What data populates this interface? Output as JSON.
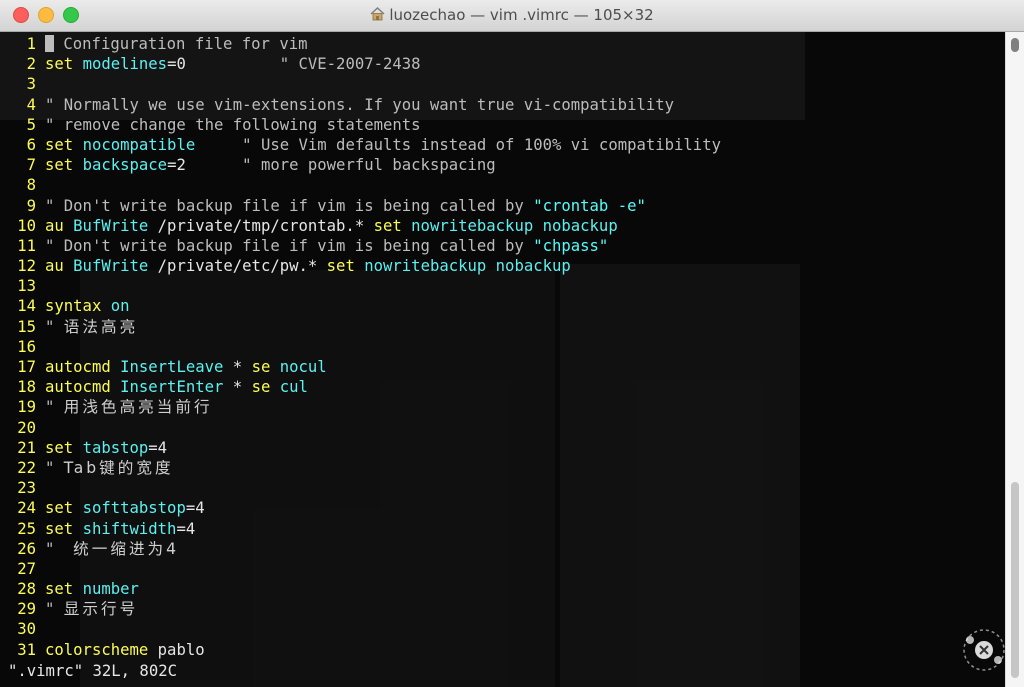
{
  "window": {
    "title": "luozechao — vim .vimrc — 105×32"
  },
  "editor": {
    "lines": [
      {
        "n": "1",
        "parts": [
          {
            "t": "cursor",
            "v": ""
          },
          {
            "t": "cmt",
            "v": " Configuration file for vim"
          }
        ]
      },
      {
        "n": "2",
        "parts": [
          {
            "t": "kw",
            "v": "set"
          },
          {
            "t": "txt",
            "v": " "
          },
          {
            "t": "opt",
            "v": "modelines"
          },
          {
            "t": "txt",
            "v": "=0"
          },
          {
            "t": "cmt",
            "v": "          \" CVE-2007-2438"
          }
        ]
      },
      {
        "n": "3",
        "parts": []
      },
      {
        "n": "4",
        "parts": [
          {
            "t": "cmt",
            "v": "\" Normally we use vim-extensions. If you want true vi-compatibility"
          }
        ]
      },
      {
        "n": "5",
        "parts": [
          {
            "t": "cmt",
            "v": "\" remove change the following statements"
          }
        ]
      },
      {
        "n": "6",
        "parts": [
          {
            "t": "kw",
            "v": "set"
          },
          {
            "t": "txt",
            "v": " "
          },
          {
            "t": "opt",
            "v": "nocompatible"
          },
          {
            "t": "cmt",
            "v": "     \" Use Vim defaults instead of 100% vi compatibility"
          }
        ]
      },
      {
        "n": "7",
        "parts": [
          {
            "t": "kw",
            "v": "set"
          },
          {
            "t": "txt",
            "v": " "
          },
          {
            "t": "opt",
            "v": "backspace"
          },
          {
            "t": "txt",
            "v": "=2"
          },
          {
            "t": "cmt",
            "v": "      \" more powerful backspacing"
          }
        ]
      },
      {
        "n": "8",
        "parts": []
      },
      {
        "n": "9",
        "parts": [
          {
            "t": "cmt",
            "v": "\" Don't write backup file if vim is being called by "
          },
          {
            "t": "str",
            "v": "\"crontab -e\""
          }
        ]
      },
      {
        "n": "10",
        "parts": [
          {
            "t": "kw",
            "v": "au"
          },
          {
            "t": "txt",
            "v": " "
          },
          {
            "t": "opt",
            "v": "BufWrite"
          },
          {
            "t": "txt",
            "v": " /private/tmp/crontab.* "
          },
          {
            "t": "kw",
            "v": "set"
          },
          {
            "t": "txt",
            "v": " "
          },
          {
            "t": "opt",
            "v": "nowritebackup nobackup"
          }
        ]
      },
      {
        "n": "11",
        "parts": [
          {
            "t": "cmt",
            "v": "\" Don't write backup file if vim is being called by "
          },
          {
            "t": "str",
            "v": "\"chpass\""
          }
        ]
      },
      {
        "n": "12",
        "parts": [
          {
            "t": "kw",
            "v": "au"
          },
          {
            "t": "txt",
            "v": " "
          },
          {
            "t": "opt",
            "v": "BufWrite"
          },
          {
            "t": "txt",
            "v": " /private/etc/pw.* "
          },
          {
            "t": "kw",
            "v": "set"
          },
          {
            "t": "txt",
            "v": " "
          },
          {
            "t": "opt",
            "v": "nowritebackup nobackup"
          }
        ]
      },
      {
        "n": "13",
        "parts": []
      },
      {
        "n": "14",
        "parts": [
          {
            "t": "kw",
            "v": "syntax"
          },
          {
            "t": "txt",
            "v": " "
          },
          {
            "t": "opt",
            "v": "on"
          }
        ]
      },
      {
        "n": "15",
        "parts": [
          {
            "t": "cmt",
            "v": "\" "
          },
          {
            "t": "cjk",
            "v": "语法高亮"
          }
        ]
      },
      {
        "n": "16",
        "parts": []
      },
      {
        "n": "17",
        "parts": [
          {
            "t": "kw",
            "v": "autocmd"
          },
          {
            "t": "txt",
            "v": " "
          },
          {
            "t": "opt",
            "v": "InsertLeave"
          },
          {
            "t": "txt",
            "v": " * "
          },
          {
            "t": "kw",
            "v": "se"
          },
          {
            "t": "txt",
            "v": " "
          },
          {
            "t": "opt",
            "v": "nocul"
          }
        ]
      },
      {
        "n": "18",
        "parts": [
          {
            "t": "kw",
            "v": "autocmd"
          },
          {
            "t": "txt",
            "v": " "
          },
          {
            "t": "opt",
            "v": "InsertEnter"
          },
          {
            "t": "txt",
            "v": " * "
          },
          {
            "t": "kw",
            "v": "se"
          },
          {
            "t": "txt",
            "v": " "
          },
          {
            "t": "opt",
            "v": "cul"
          }
        ]
      },
      {
        "n": "19",
        "parts": [
          {
            "t": "cmt",
            "v": "\" "
          },
          {
            "t": "cjk",
            "v": "用浅色高亮当前行"
          }
        ]
      },
      {
        "n": "20",
        "parts": []
      },
      {
        "n": "21",
        "parts": [
          {
            "t": "kw",
            "v": "set"
          },
          {
            "t": "txt",
            "v": " "
          },
          {
            "t": "opt",
            "v": "tabstop"
          },
          {
            "t": "txt",
            "v": "=4"
          }
        ]
      },
      {
        "n": "22",
        "parts": [
          {
            "t": "cmt",
            "v": "\" "
          },
          {
            "t": "cjk",
            "v": "Tab键的宽度"
          }
        ]
      },
      {
        "n": "23",
        "parts": []
      },
      {
        "n": "24",
        "parts": [
          {
            "t": "kw",
            "v": "set"
          },
          {
            "t": "txt",
            "v": " "
          },
          {
            "t": "opt",
            "v": "softtabstop"
          },
          {
            "t": "txt",
            "v": "=4"
          }
        ]
      },
      {
        "n": "25",
        "parts": [
          {
            "t": "kw",
            "v": "set"
          },
          {
            "t": "txt",
            "v": " "
          },
          {
            "t": "opt",
            "v": "shiftwidth"
          },
          {
            "t": "txt",
            "v": "=4"
          }
        ]
      },
      {
        "n": "26",
        "parts": [
          {
            "t": "cmt",
            "v": "\"  "
          },
          {
            "t": "cjk",
            "v": "统一缩进为4"
          }
        ]
      },
      {
        "n": "27",
        "parts": []
      },
      {
        "n": "28",
        "parts": [
          {
            "t": "kw",
            "v": "set"
          },
          {
            "t": "txt",
            "v": " "
          },
          {
            "t": "opt",
            "v": "number"
          }
        ]
      },
      {
        "n": "29",
        "parts": [
          {
            "t": "cmt",
            "v": "\" "
          },
          {
            "t": "cjk",
            "v": "显示行号"
          }
        ]
      },
      {
        "n": "30",
        "parts": []
      },
      {
        "n": "31",
        "parts": [
          {
            "t": "kw",
            "v": "colorscheme"
          },
          {
            "t": "txt",
            "v": " pablo"
          }
        ]
      }
    ],
    "status_line": "\".vimrc\" 32L, 802C"
  },
  "colors": {
    "keyword": "#fcfc54",
    "option": "#5cf0f0",
    "string": "#54fcfc",
    "line_number": "#fcfc54",
    "background": "#080808"
  },
  "icons": {
    "title_icon": "home-folder-icon",
    "watermark": "runner-logo-icon"
  }
}
